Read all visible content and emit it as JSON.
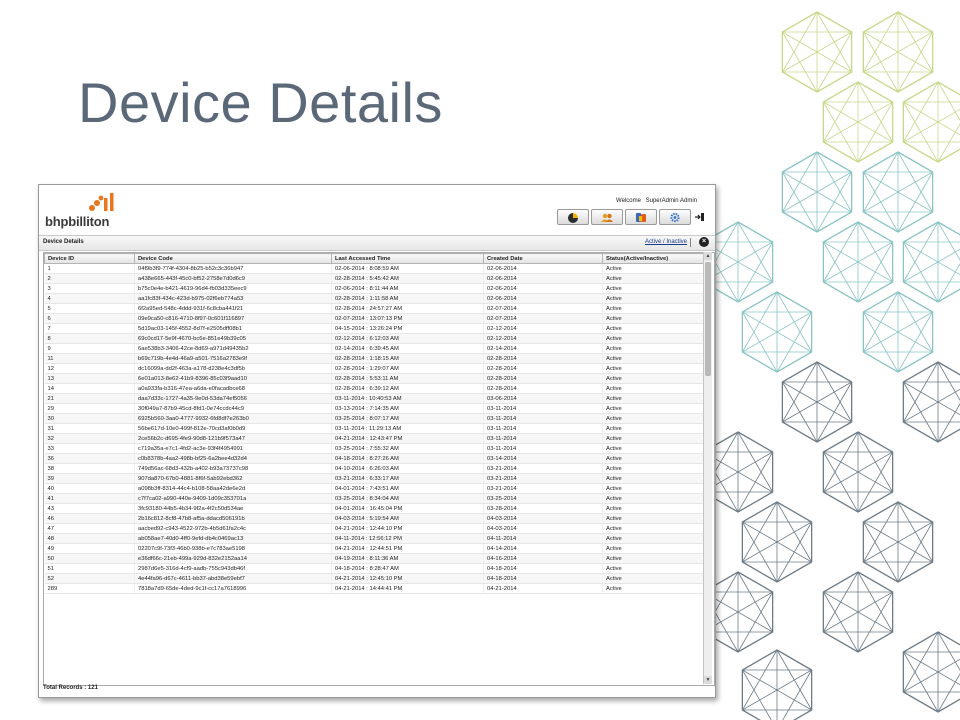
{
  "slide": {
    "title": "Device Details"
  },
  "app": {
    "logo_text": "bhpbilliton",
    "welcome_prefix": "Welcome",
    "user_name": "SuperAdmin Admin",
    "toolbar": [
      {
        "icon": "pie-chart-icon"
      },
      {
        "icon": "users-icon"
      },
      {
        "icon": "devices-icon"
      },
      {
        "icon": "settings-icon"
      }
    ],
    "logout_icon": "logout-icon",
    "section_title": "Device Details",
    "filter_link": "Active / Inactive",
    "close_icon": "close-icon",
    "total_records": "Total Records : 121"
  },
  "table": {
    "headers": [
      "Device ID",
      "Device Code",
      "Last Accessed Time",
      "Created Date",
      "Status(Active/Inactive)"
    ],
    "rows": [
      [
        "1",
        "04f9b3f9-774f-4304-8b25-b52c3c36b947",
        "02-06-2014 : 8:08:59 AM",
        "02-06-2014",
        "Active"
      ],
      [
        "2",
        "a438e665-443f-45c0-bf52-2758e7d0d6c9",
        "02-28-2014 : 5:45:42 AM",
        "02-06-2014",
        "Active"
      ],
      [
        "3",
        "b75c0e4e-b421-4619-96d4-fb03d335eec9",
        "02-06-2014 : 8:11:44 AM",
        "02-06-2014",
        "Active"
      ],
      [
        "4",
        "aa1fc83f-434c-423d-b975-02f6eb774a53",
        "02-28-2014 : 1:11:58 AM",
        "02-06-2014",
        "Active"
      ],
      [
        "5",
        "6f2a95ed-548c-4ddd-931f-6c8cba441f21",
        "02-28-2014 : 24:57:27 AM",
        "02-07-2014",
        "Active"
      ],
      [
        "6",
        "09e9ca50-c816-4710-8f97-0c601f116897",
        "02-07-2014 : 13:07:13 PM",
        "02-07-2014",
        "Active"
      ],
      [
        "7",
        "5d19ac03-145f-4552-8d7f-e2505dff08b1",
        "04-15-2014 : 13:26:24 PM",
        "02-12-2014",
        "Active"
      ],
      [
        "8",
        "69c0cd17-5e9f-4670-bc6e-851e49b39c05",
        "02-12-2014 : 6:12:03 AM",
        "02-12-2014",
        "Active"
      ],
      [
        "9",
        "6ae538b3-3406-42ce-8d69-a971d49435b2",
        "02-14-2014 : 6:39:45 AM",
        "02-14-2014",
        "Active"
      ],
      [
        "11",
        "b69c719b-4e4d-46a9-a501-7516a2783e9f",
        "02-28-2014 : 1:18:15 AM",
        "02-28-2014",
        "Active"
      ],
      [
        "12",
        "dc16099a-dd2f-463a-a178-d238e4c3df5b",
        "02-28-2014 : 1:29:07 AM",
        "02-28-2014",
        "Active"
      ],
      [
        "13",
        "6e01a013-8e62-41b9-8396-85c03f9aad10",
        "02-28-2014 : 5:53:11 AM",
        "02-28-2014",
        "Active"
      ],
      [
        "14",
        "a0a933fa-b316-47ea-a6da-e0facadbce68",
        "02-28-2014 : 6:39:12 AM",
        "02-28-2014",
        "Active"
      ],
      [
        "21",
        "daa7d33c-1727-4a35-9e0d-53da74ef5056",
        "03-11-2014 : 10:40:53 AM",
        "03-06-2014",
        "Active"
      ],
      [
        "29",
        "30f049a7-87b9-45cd-8fd1-0e74ccdc44c9",
        "03-13-2014 : 7:14:35 AM",
        "03-11-2014",
        "Active"
      ],
      [
        "30",
        "6925b560-3aa0-4777-9932-6fd8df7e263b0",
        "03-25-2014 : 8:07:17 AM",
        "03-11-2014",
        "Active"
      ],
      [
        "31",
        "56be617d-10e0-499f-812e-70cd3af0b0d9",
        "03-11-2014 : 11:29:13 AM",
        "03-11-2014",
        "Active"
      ],
      [
        "32",
        "2ce56b2c-d695-4fe9-90d8-121b9f573a47",
        "04-21-2014 : 12:43:47 PM",
        "03-11-2014",
        "Active"
      ],
      [
        "33",
        "c719a35a-e7c1-4fd2-ac3e-93f4f4954991",
        "03-25-2014 : 7:55:32 AM",
        "03-11-2014",
        "Active"
      ],
      [
        "36",
        "c0b8378b-4aa2-498b-bf25-6a2bee4d32d4",
        "04-18-2014 : 8:27:26 AM",
        "03-14-2014",
        "Active"
      ],
      [
        "38",
        "749d56ac-68d3-432b-a402-b93a73737c98",
        "04-10-2014 : 6:26:03 AM",
        "03-21-2014",
        "Active"
      ],
      [
        "39",
        "907da870-67b0-4881-8f6f-5ab92ebd362",
        "03-21-2014 : 6:33:17 AM",
        "03-21-2014",
        "Active"
      ],
      [
        "40",
        "a098b3ff-8314-44c4-b108-58aa42de6e2d",
        "04-01-2014 : 7:43:51 AM",
        "03-21-2014",
        "Active"
      ],
      [
        "41",
        "c7f7ca02-a990-440e-9409-1d09c353701a",
        "03-25-2014 : 8:34:04 AM",
        "03-25-2014",
        "Active"
      ],
      [
        "43",
        "3fc93180-44b5-4b34-9f2a-4f2c50d534ae",
        "04-01-2014 : 16:45:04 PM",
        "03-28-2014",
        "Active"
      ],
      [
        "46",
        "2b16c812-8cf8-47b8-af5a-ddacd506191b",
        "04-03-2014 : 5:19:54 AM",
        "04-03-2014",
        "Active"
      ],
      [
        "47",
        "aacbed92-c943-4522-972b-4b5d61fa2c4c",
        "04-21-2014 : 12:44:10 PM",
        "04-03-2014",
        "Active"
      ],
      [
        "48",
        "ab058ae7-40d0-4ff0-9efd-db4c0469ac13",
        "04-11-2014 : 12:56:12 PM",
        "04-11-2014",
        "Active"
      ],
      [
        "49",
        "02207c9f-73f3-46b0-938b-e7c783ae5198",
        "04-21-2014 : 12:44:51 PM",
        "04-14-2014",
        "Active"
      ],
      [
        "50",
        "e36df66c-21eb-499a-929d-832e2152aa14",
        "04-19-2014 : 8:11:36 AM",
        "04-16-2014",
        "Active"
      ],
      [
        "51",
        "2987d6e5-316d-4cf9-aadb-755c943db46f",
        "04-18-2014 : 8:28:47 AM",
        "04-18-2014",
        "Active"
      ],
      [
        "52",
        "4e44fa96-d67c-4611-bb37-abd38e59ebf7",
        "04-21-2014 : 12:45:10 PM",
        "04-18-2014",
        "Active"
      ],
      [
        "289",
        "7818a7d9-65de-4ded-9c1f-cc17a7618996",
        "04-21-2014 : 14:44:41 PM",
        "04-21-2014",
        "Active"
      ]
    ]
  },
  "colors": {
    "title": "#5a6878",
    "pattern_green": "#c8d88a",
    "pattern_teal": "#8cc4c4",
    "pattern_gray": "#6e7c86"
  }
}
